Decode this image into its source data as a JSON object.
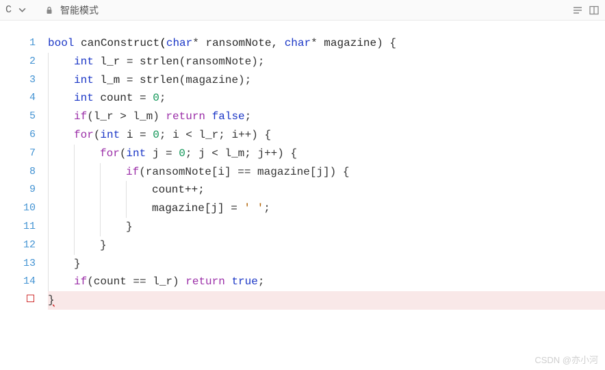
{
  "toolbar": {
    "lang_letter": "C",
    "mode_label": "智能模式"
  },
  "gutter": {
    "line_numbers": [
      "1",
      "2",
      "3",
      "4",
      "5",
      "6",
      "7",
      "8",
      "9",
      "10",
      "11",
      "12",
      "13",
      "14",
      ""
    ]
  },
  "code": {
    "lines": [
      {
        "t": "bool",
        "c": "k-type",
        "pre": "",
        "post": " "
      },
      {
        "fn": "canConstruct",
        "args": [
          {
            "t": "char",
            "c": "k-type"
          },
          {
            "t": "*"
          },
          {
            "t": " ransomNote, "
          },
          {
            "t": "char",
            "c": "k-type"
          },
          {
            "t": "*"
          },
          {
            "t": " magazine"
          }
        ]
      }
    ],
    "l1": {
      "kw": "bool",
      "fn": "canConstruct",
      "p1t": "char",
      "p1s": "*",
      "p1n": " ransomNote, ",
      "p2t": "char",
      "p2s": "*",
      "p2n": " magazine",
      "end": ") {"
    },
    "l2": {
      "kw": "int",
      "id": " l_r = ",
      "fn": "strlen",
      "arg": "(ransomNote);"
    },
    "l3": {
      "kw": "int",
      "id": " l_m = ",
      "fn": "strlen",
      "arg": "(magazine);"
    },
    "l4": {
      "kw": "int",
      "id": " count = ",
      "num": "0",
      "end": ";"
    },
    "l5": {
      "kw": "if",
      "pre": "(l_r > l_m) ",
      "ret": "return",
      "sp": " ",
      "val": "false",
      "end": ";"
    },
    "l6": {
      "kw": "for",
      "open": "(",
      "t": "int",
      "v": " i = ",
      "n0": "0",
      "mid": "; i < l_r; i++) {"
    },
    "l7": {
      "kw": "for",
      "open": "(",
      "t": "int",
      "v": " j = ",
      "n0": "0",
      "mid": "; j < l_m; j++) {"
    },
    "l8": {
      "kw": "if",
      "body": "(ransomNote[i] == magazine[j]) {"
    },
    "l9": {
      "body": "count++;"
    },
    "l10": {
      "pre": "magazine[j] = ",
      "ch": "' '",
      "end": ";"
    },
    "l11": {
      "body": "}"
    },
    "l12": {
      "body": "}"
    },
    "l13": {
      "body": "}"
    },
    "l14": {
      "kw": "if",
      "pre": "(count == l_r) ",
      "ret": "return",
      "sp": " ",
      "val": "true",
      "end": ";"
    },
    "l15": {
      "body": "}"
    }
  },
  "watermark": "CSDN @亦小河"
}
